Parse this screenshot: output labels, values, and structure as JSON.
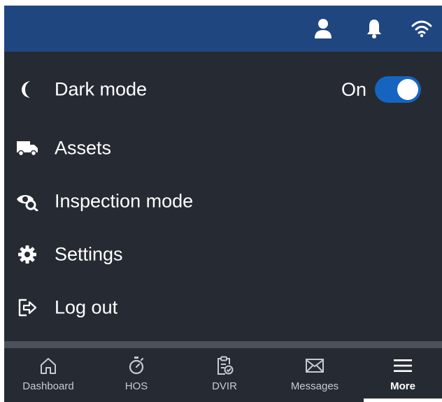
{
  "header": {
    "icons": [
      "user-icon",
      "bell-icon",
      "wifi-icon"
    ]
  },
  "menu": {
    "dark_mode": {
      "label": "Dark mode",
      "state": "On",
      "icon": "moon-icon",
      "enabled": true
    },
    "assets": {
      "label": "Assets",
      "icon": "truck-icon"
    },
    "inspection": {
      "label": "Inspection mode",
      "icon": "eye-search-icon"
    },
    "settings": {
      "label": "Settings",
      "icon": "gear-icon"
    },
    "logout": {
      "label": "Log out",
      "icon": "logout-icon"
    }
  },
  "bottom_nav": {
    "items": [
      {
        "label": "Dashboard",
        "icon": "home-icon"
      },
      {
        "label": "HOS",
        "icon": "stopwatch-icon"
      },
      {
        "label": "DVIR",
        "icon": "clipboard-check-icon"
      },
      {
        "label": "Messages",
        "icon": "envelope-icon"
      },
      {
        "label": "More",
        "icon": "hamburger-icon",
        "active": true
      }
    ]
  },
  "colors": {
    "header_bg": "#1f467f",
    "menu_bg": "#262b33",
    "toggle_on": "#1565c0",
    "text": "#ffffff"
  }
}
